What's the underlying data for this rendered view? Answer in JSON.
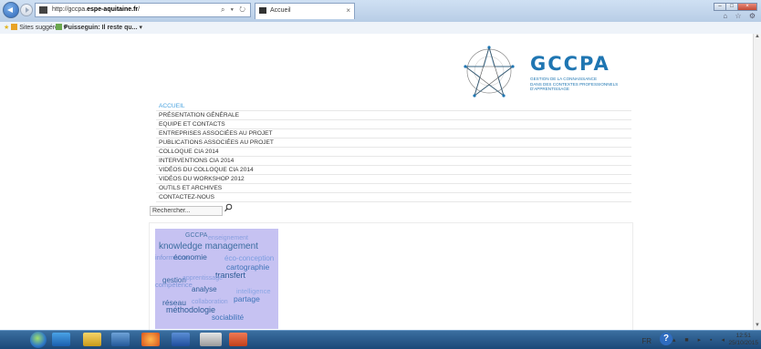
{
  "browser": {
    "url_prefix": "http://gccpa.",
    "url_host": "espe-aquitaine.fr",
    "url_suffix": "/",
    "address_tools": "⌕ ▾ ↻",
    "tab_title": "Accueil",
    "tab_close": "×",
    "win_min": "–",
    "win_max": "□",
    "win_close": "×",
    "tool_icons": "⌂ ☆ ⚙"
  },
  "favorites": {
    "suggested": "Sites suggérés ▾",
    "current_bold": "Puisseguin: Il reste qu...",
    "current_arrow": "▾"
  },
  "logo": {
    "title": "GCCPA",
    "subtitle": "GESTION DE LA CONNAISSANCE\nDANS DES CONTEXTES PROFESSIONNELS\nD'APPRENTISSAGE"
  },
  "menu": {
    "items": [
      "ACCUEIL",
      "PRÉSENTATION GÉNÉRALE",
      "EQUIPE ET CONTACTS",
      "ENTREPRISES ASSOCIÉES AU PROJET",
      "PUBLICATIONS ASSOCIÉES AU PROJET",
      "COLLOQUE CIA 2014",
      "INTERVENTIONS CIA 2014",
      "VIDÉOS DU COLLOQUE CIA 2014",
      "VIDÉOS DU WORKSHOP 2012",
      "OUTILS ET ARCHIVES",
      "CONTACTEZ-NOUS"
    ],
    "active_index": 0
  },
  "search": {
    "value": "Rechercher..."
  },
  "cloud": {
    "words": [
      "GCCPA",
      "enseignement",
      "knowledge management",
      "information",
      "économie",
      "éco-conception",
      "cartographie",
      "transfert",
      "gestion",
      "apprentissage",
      "compétence",
      "analyse",
      "intelligence",
      "partage",
      "réseau",
      "collaboration",
      "méthodologie",
      "sociabilité"
    ]
  },
  "taskbar": {
    "lang": "FR",
    "help": "?",
    "tray_icons": "▴ ■ ▸ ▪ ◂",
    "time": "12:51",
    "date": "25/10/2015"
  }
}
